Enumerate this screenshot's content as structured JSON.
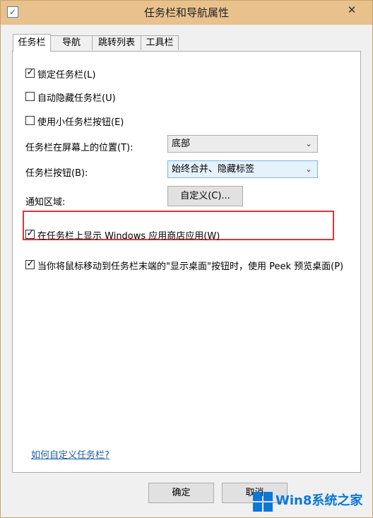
{
  "window": {
    "title": "任务栏和导航属性",
    "close_glyph": "✕"
  },
  "tabs": [
    {
      "label": "任务栏"
    },
    {
      "label": "导航"
    },
    {
      "label": "跳转列表"
    },
    {
      "label": "工具栏"
    }
  ],
  "options": {
    "lock_taskbar": {
      "label": "锁定任务栏(L)",
      "checked": true
    },
    "auto_hide": {
      "label": "自动隐藏任务栏(U)",
      "checked": false
    },
    "small_buttons": {
      "label": "使用小任务栏按钮(E)",
      "checked": false
    },
    "show_store_apps": {
      "label": "在任务栏上显示 Windows 应用商店应用(W)",
      "checked": true
    },
    "peek": {
      "label": "当你将鼠标移动到任务栏末端的\"显示桌面\"按钮时，使用 Peek 预览桌面(P)",
      "checked": true
    }
  },
  "location": {
    "label": "任务栏在屏幕上的位置(T):",
    "value": "底部"
  },
  "buttons_combine": {
    "label": "任务栏按钮(B):",
    "value": "始终合并、隐藏标签"
  },
  "notification_area": {
    "label": "通知区域:",
    "button": "自定义(C)..."
  },
  "help_link": "如何自定义任务栏?",
  "footer": {
    "ok": "确定",
    "cancel": "取消"
  },
  "watermark": "Win8系统之家",
  "colors": {
    "highlight": "#e53333",
    "link": "#1d5ea5",
    "titlebar": "#e8c18d",
    "watermark": "#0a78d8"
  }
}
